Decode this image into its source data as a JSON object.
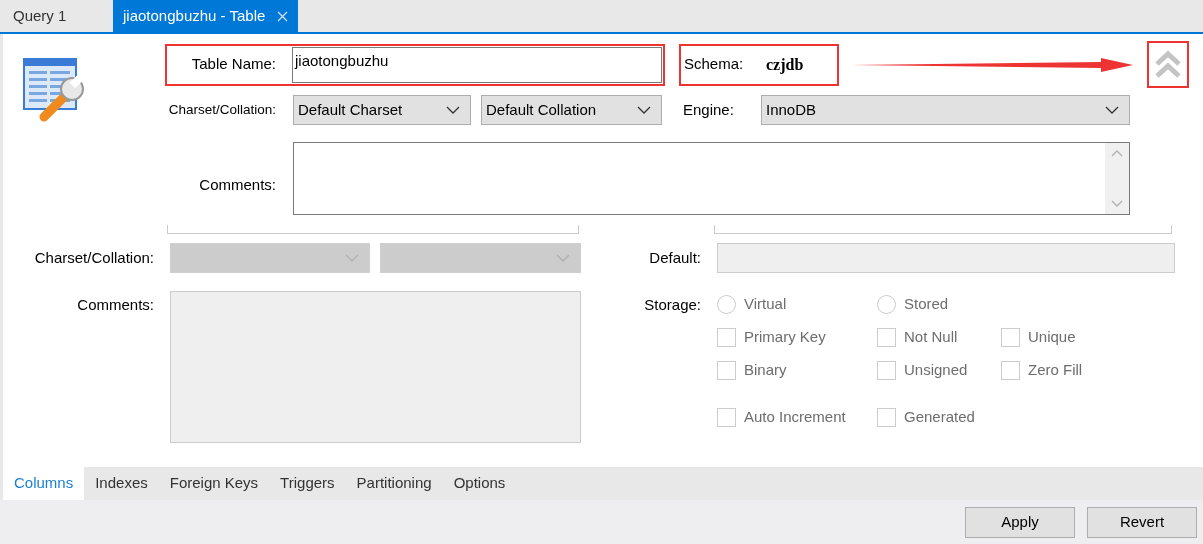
{
  "tabs": [
    {
      "label": "Query 1",
      "selected": false,
      "closable": false
    },
    {
      "label": "jiaotongbuzhu - Table",
      "selected": true,
      "closable": true
    }
  ],
  "table": {
    "name_label": "Table Name:",
    "name": "jiaotongbuzhu",
    "schema_label": "Schema:",
    "schema": "czjdb",
    "charset_label": "Charset/Collation:",
    "charset": "Default Charset",
    "collation": "Default Collation",
    "engine_label": "Engine:",
    "engine": "InnoDB",
    "comments_label": "Comments:"
  },
  "column": {
    "disabled": true,
    "charset_label": "Charset/Collation:",
    "comments_label": "Comments:",
    "default_label": "Default:",
    "storage_label": "Storage:",
    "options": [
      [
        {
          "kind": "radio",
          "label": "Virtual",
          "checked": false
        },
        {
          "kind": "radio",
          "label": "Stored",
          "checked": false
        }
      ],
      [
        {
          "kind": "checkbox",
          "label": "Primary Key",
          "checked": false
        },
        {
          "kind": "checkbox",
          "label": "Not Null",
          "checked": false
        },
        {
          "kind": "checkbox",
          "label": "Unique",
          "checked": false
        }
      ],
      [
        {
          "kind": "checkbox",
          "label": "Binary",
          "checked": false
        },
        {
          "kind": "checkbox",
          "label": "Unsigned",
          "checked": false
        },
        {
          "kind": "checkbox",
          "label": "Zero Fill",
          "checked": false
        }
      ],
      [
        {
          "kind": "checkbox",
          "label": "Auto Increment",
          "checked": false
        },
        {
          "kind": "checkbox",
          "label": "Generated",
          "checked": false
        }
      ]
    ]
  },
  "bottom_tabs": [
    {
      "label": "Columns",
      "selected": true
    },
    {
      "label": "Indexes",
      "selected": false
    },
    {
      "label": "Foreign Keys",
      "selected": false
    },
    {
      "label": "Triggers",
      "selected": false
    },
    {
      "label": "Partitioning",
      "selected": false
    },
    {
      "label": "Options",
      "selected": false
    }
  ],
  "buttons": [
    "Apply",
    "Revert"
  ]
}
